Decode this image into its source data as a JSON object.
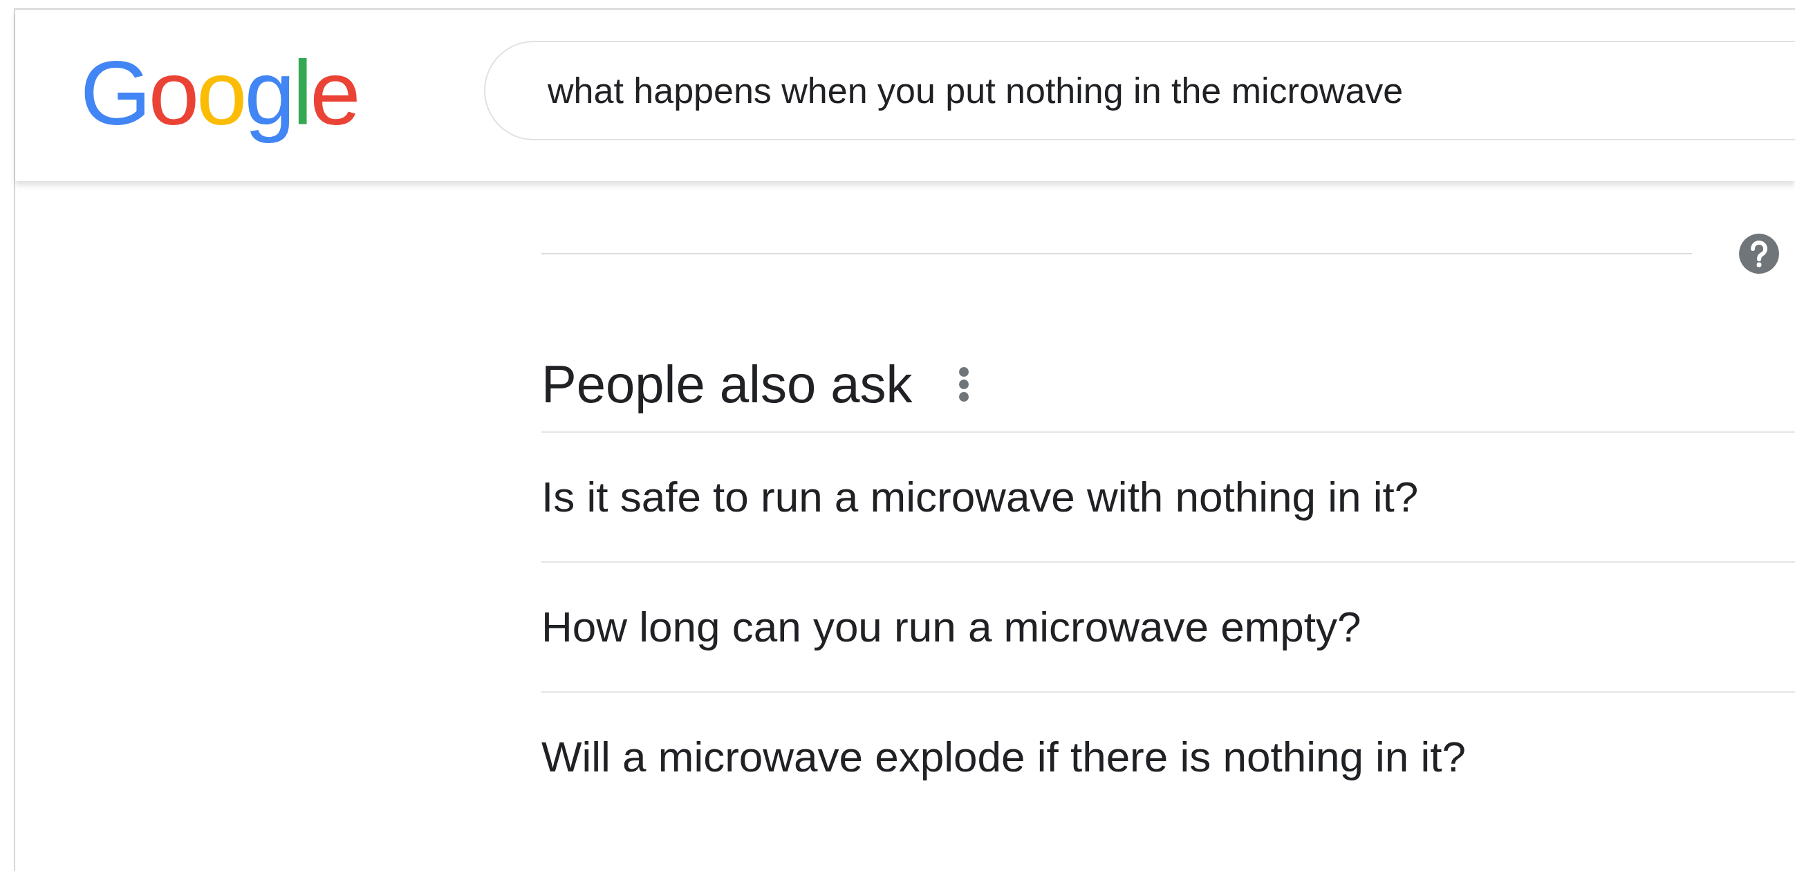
{
  "logo": {
    "letters": [
      {
        "char": "G",
        "color": "#4285f4"
      },
      {
        "char": "o",
        "color": "#ea4335"
      },
      {
        "char": "o",
        "color": "#fbbc05"
      },
      {
        "char": "g",
        "color": "#4285f4"
      },
      {
        "char": "l",
        "color": "#34a853"
      },
      {
        "char": "e",
        "color": "#ea4335"
      }
    ]
  },
  "search": {
    "value": "what happens when you put nothing in the microwave"
  },
  "people_also_ask": {
    "title": "People also ask",
    "questions": [
      "Is it safe to run a microwave with nothing in it?",
      "How long can you run a microwave empty?",
      "Will a microwave explode if there is nothing in it?"
    ]
  }
}
